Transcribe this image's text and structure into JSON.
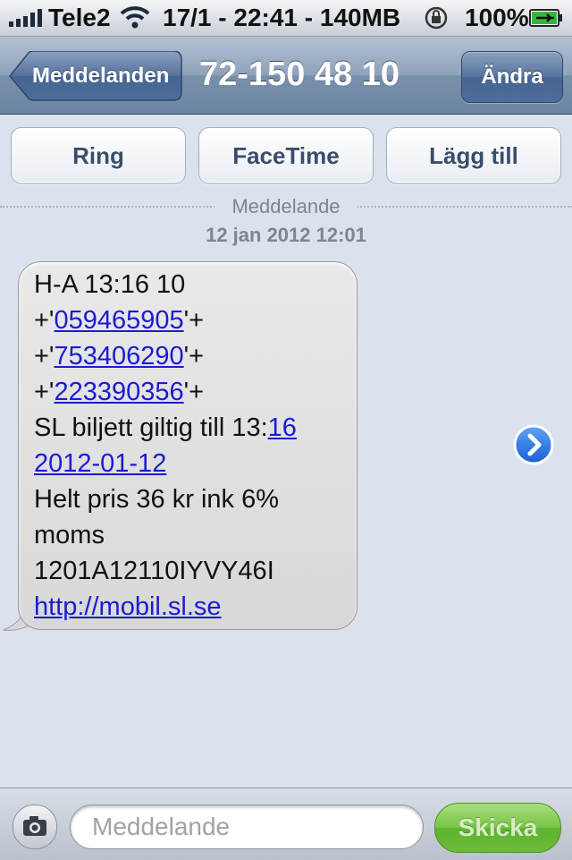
{
  "status_bar": {
    "carrier": "Tele2",
    "center": "17/1 - 22:41 - 140MB",
    "battery": "100%"
  },
  "nav": {
    "back_label": "Meddelanden",
    "title": "72-150 48 10",
    "edit_label": "Ändra"
  },
  "actions": {
    "call_label": "Ring",
    "facetime_label": "FaceTime",
    "add_label": "Lägg till"
  },
  "thread": {
    "label": "Meddelande",
    "date": "12 jan 2012 12:01"
  },
  "message": {
    "line1": "H-A 13:16 10",
    "code1_prefix": "+'",
    "code1": "059465905",
    "code1_suffix": "'+",
    "code2_prefix": "+'",
    "code2": "753406290",
    "code2_suffix": "'+",
    "code3_prefix": "+'",
    "code3": "223390356",
    "code3_suffix": "'+",
    "valid_prefix": "SL biljett giltig till 13:",
    "valid_link_part1": "16",
    "valid_link_part2": "2012-01-12",
    "price_line1": "Helt pris 36 kr ink 6%",
    "price_line2": "moms",
    "ref": "1201A12110IYVY46I",
    "url": "http://mobil.sl.se"
  },
  "composer": {
    "placeholder": "Meddelande",
    "send_label": "Skicka"
  },
  "icons": {
    "signal": "signal-bars-icon",
    "wifi": "wifi-icon",
    "lock": "rotation-lock-icon",
    "battery": "battery-charging-icon",
    "back": "back-chevron",
    "detail": "detail-disclosure-icon",
    "camera": "camera-icon"
  },
  "colors": {
    "nav_blue": "#6c85a3",
    "bubble_gray": "#e0e0e0",
    "link_blue": "#1b1bd4",
    "send_green": "#6cbc3b",
    "background": "#dbe2ed"
  }
}
